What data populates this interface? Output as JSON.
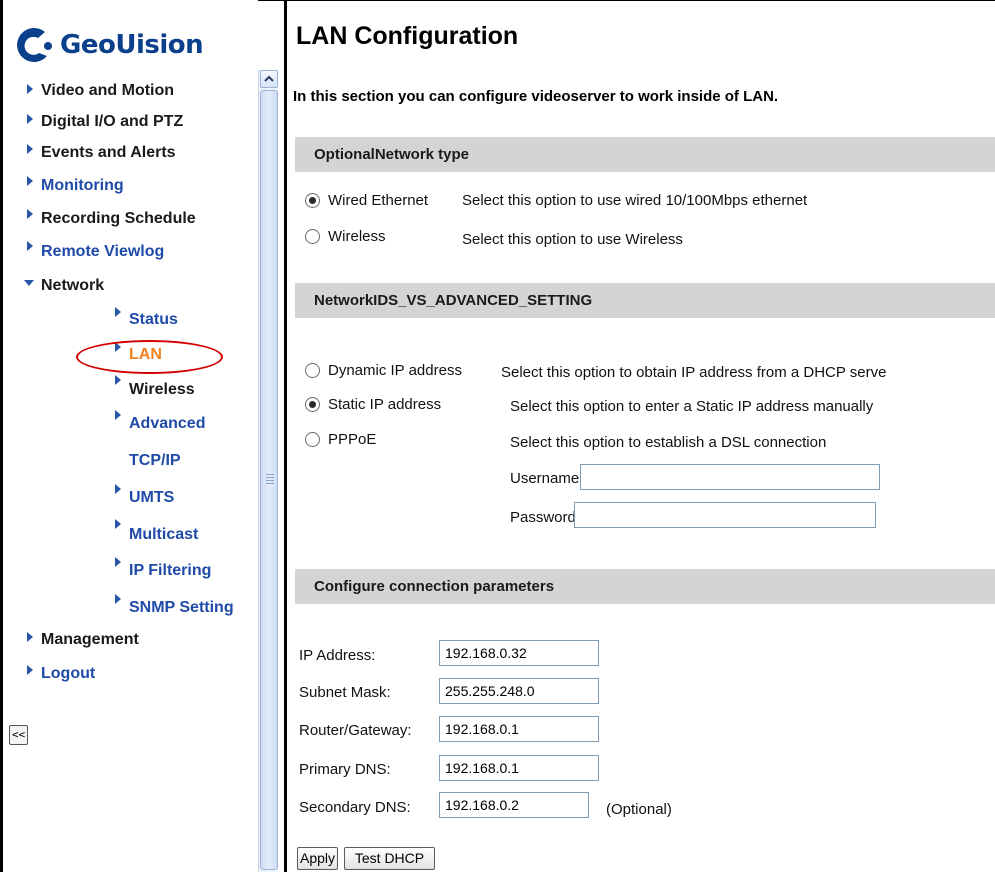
{
  "brand": {
    "name": "GeoUision"
  },
  "sidebar": {
    "items": [
      {
        "label": "Video and Motion"
      },
      {
        "label": "Digital I/O and PTZ"
      },
      {
        "label": "Events and Alerts"
      },
      {
        "label": "Monitoring"
      },
      {
        "label": "Recording Schedule"
      },
      {
        "label": "Remote Viewlog"
      },
      {
        "label": "Network"
      },
      {
        "label": "Management"
      },
      {
        "label": "Logout"
      }
    ],
    "network_sub": [
      {
        "label": "Status"
      },
      {
        "label": "LAN"
      },
      {
        "label": "Wireless"
      },
      {
        "label": "Advanced"
      },
      {
        "label": "TCP/IP"
      },
      {
        "label": "UMTS"
      },
      {
        "label": "Multicast"
      },
      {
        "label": "IP Filtering"
      },
      {
        "label": "SNMP Setting"
      }
    ],
    "collapse_label": "<<",
    "active_item": "LAN",
    "colors": {
      "link_blue": "#1f4aa8",
      "active_orange": "#f2811d",
      "highlight_circle": "#d40000"
    }
  },
  "main": {
    "title": "LAN Configuration",
    "intro": "In this section you can configure videoserver to work inside of LAN.",
    "network_type": {
      "header": "OptionalNetwork type",
      "options": [
        {
          "label": "Wired Ethernet",
          "desc": "Select this option to use wired 10/100Mbps ethernet",
          "checked": true
        },
        {
          "label": "Wireless",
          "desc": "Select this option to use Wireless",
          "checked": false
        }
      ]
    },
    "advanced": {
      "header": "NetworkIDS_VS_ADVANCED_SETTING",
      "options": [
        {
          "label": "Dynamic IP address",
          "desc": "Select this option to obtain IP address from a DHCP serve",
          "checked": false
        },
        {
          "label": "Static IP address",
          "desc": "Select this option to enter a Static IP address manually",
          "checked": true
        },
        {
          "label": "PPPoE",
          "desc": "Select this option to establish a DSL connection",
          "checked": false
        }
      ],
      "username_label": "Username:",
      "username_value": "",
      "password_label": "Password:",
      "password_value": ""
    },
    "connection": {
      "header": "Configure connection parameters",
      "fields": [
        {
          "label": "IP Address:",
          "value": "192.168.0.32"
        },
        {
          "label": "Subnet Mask:",
          "value": "255.255.248.0"
        },
        {
          "label": "Router/Gateway:",
          "value": "192.168.0.1"
        },
        {
          "label": "Primary DNS:",
          "value": "192.168.0.1"
        },
        {
          "label": "Secondary DNS:",
          "value": "192.168.0.2"
        }
      ],
      "optional_note": "(Optional)"
    },
    "buttons": {
      "apply": "Apply",
      "test_dhcp": "Test DHCP"
    }
  }
}
